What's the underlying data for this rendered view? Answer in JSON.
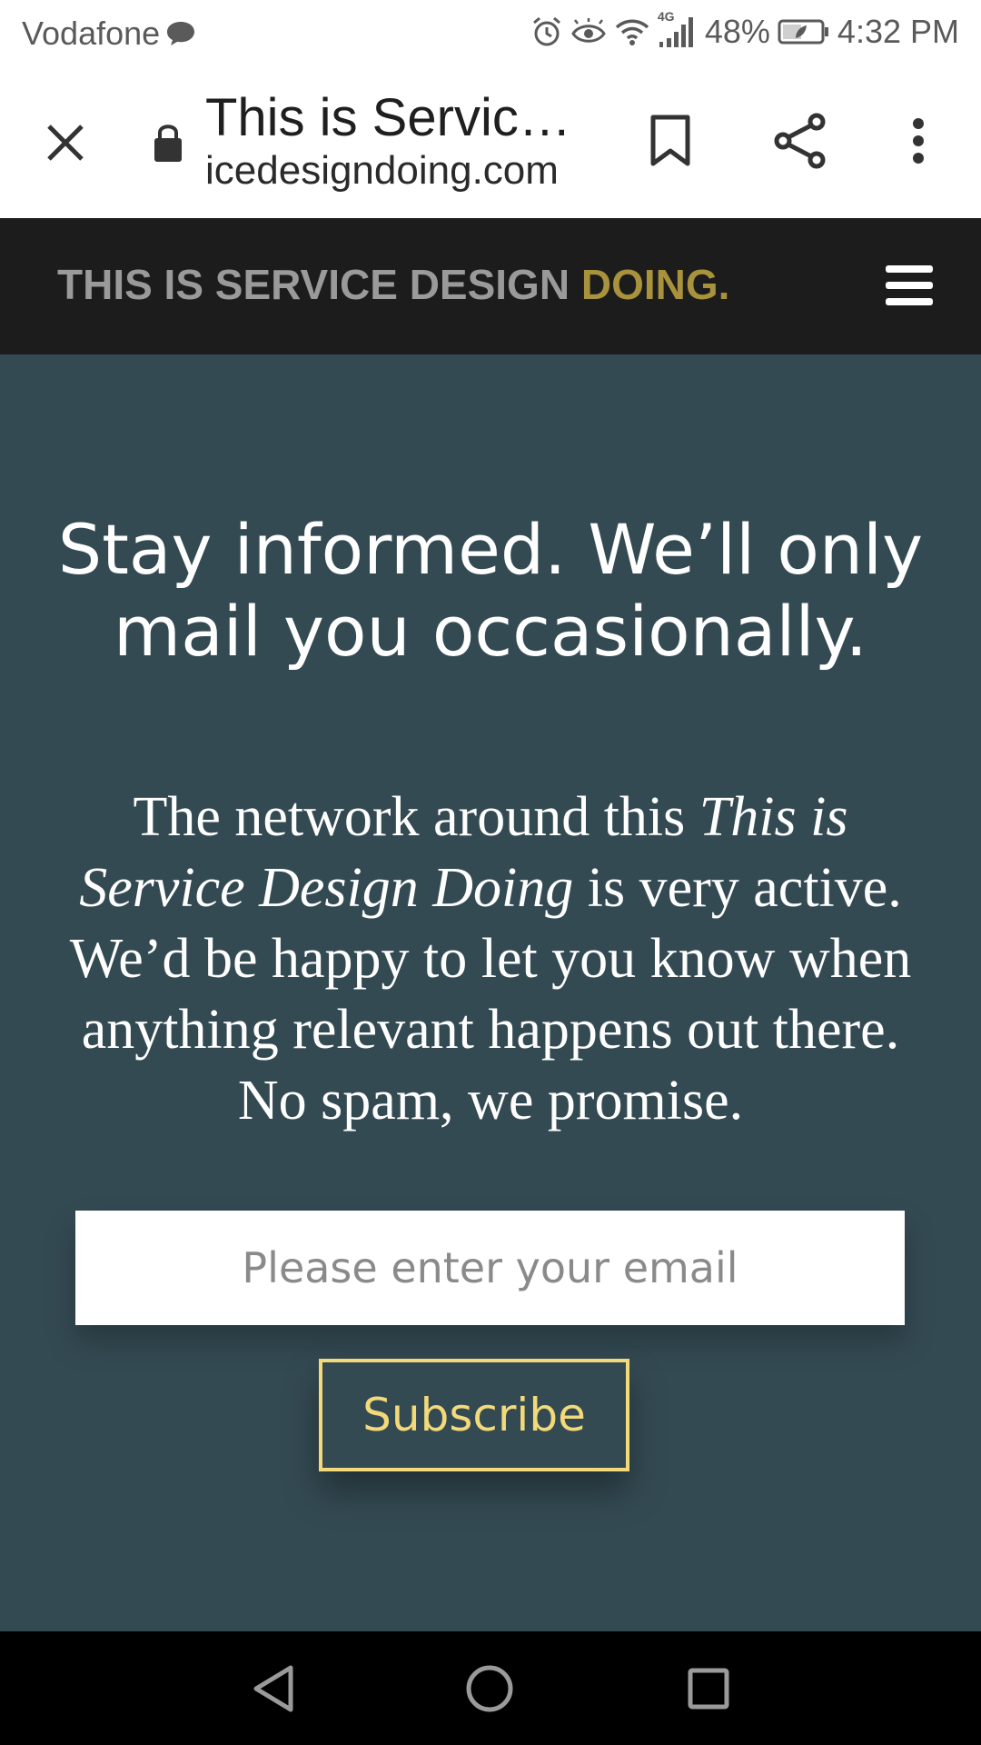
{
  "status_bar": {
    "carrier": "Vodafone",
    "network": "4G",
    "battery": "48%",
    "time": "4:32 PM",
    "icons": [
      "message-icon",
      "alarm-icon",
      "eye-comfort-icon",
      "wifi-icon",
      "signal-icon",
      "battery-icon"
    ]
  },
  "browser": {
    "page_title": "This is Servic…",
    "url": "icedesigndoing.com",
    "icons": [
      "close-icon",
      "lock-icon",
      "bookmark-icon",
      "share-icon",
      "more-vert-icon"
    ]
  },
  "site_header": {
    "brand_main": "THIS IS SERVICE DESIGN ",
    "brand_accent": "DOING.",
    "menu_icon": "hamburger-menu-icon",
    "accent_color": "#a8923b"
  },
  "newsletter": {
    "headline": "Stay informed. We’ll only mail you occasionally.",
    "body_pre": "The network around this ",
    "body_italic": "This is Service Design Doing",
    "body_post": " is very active. We’d be happy to let you know when anything relevant happens out there. No spam, we promise.",
    "email_placeholder": "Please enter your email",
    "email_value": "",
    "subscribe_label": "Subscribe",
    "background_color": "#344a53",
    "button_color": "#f2d97a"
  },
  "nav_bar": {
    "icons": [
      "back-icon",
      "home-icon",
      "recents-icon"
    ]
  }
}
